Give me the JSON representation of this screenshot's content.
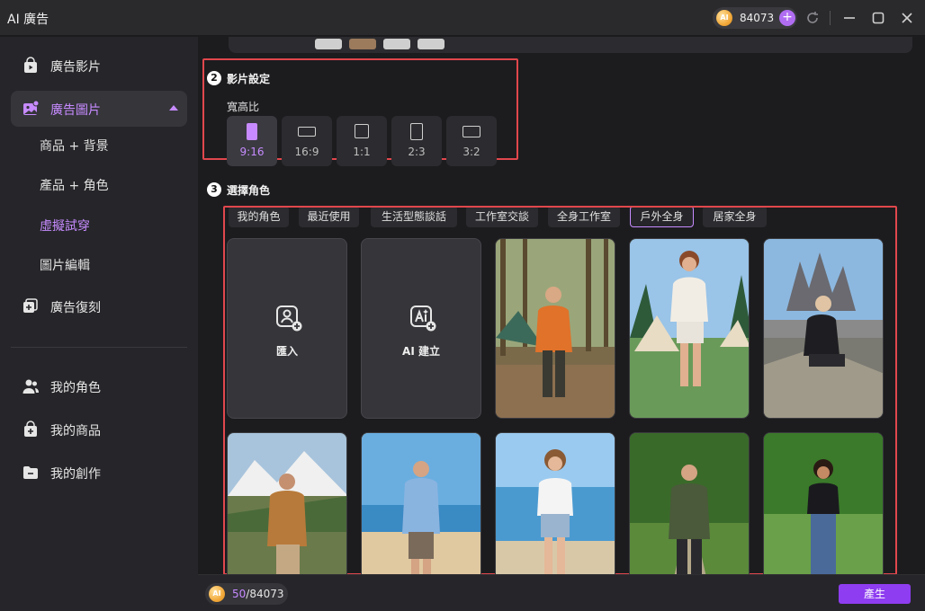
{
  "app": {
    "title": "AI 廣告"
  },
  "titlebar": {
    "credits": "84073",
    "coin_label": "AI"
  },
  "sidebar": {
    "items": [
      {
        "label": "廣告影片",
        "icon": "video-bag-icon"
      },
      {
        "label": "廣告圖片",
        "icon": "image-bag-icon",
        "active": true,
        "expanded": true
      },
      {
        "label": "廣告復刻",
        "icon": "replicate-icon"
      },
      {
        "label": "我的角色",
        "icon": "users-icon"
      },
      {
        "label": "我的商品",
        "icon": "shopping-bag-icon"
      },
      {
        "label": "我的創作",
        "icon": "folder-icon"
      }
    ],
    "sub_items": [
      {
        "label": "商品 + 背景"
      },
      {
        "label": "產品 + 角色"
      },
      {
        "label": "虛擬試穿",
        "active": true
      },
      {
        "label": "圖片編輯"
      }
    ]
  },
  "video_settings": {
    "step": "2",
    "title": "影片設定",
    "aspect_label": "寬高比",
    "ratios": [
      {
        "label": "9:16",
        "active": true
      },
      {
        "label": "16:9"
      },
      {
        "label": "1:1"
      },
      {
        "label": "2:3"
      },
      {
        "label": "3:2"
      }
    ]
  },
  "character_select": {
    "step": "3",
    "title": "選擇角色",
    "tabs": [
      {
        "label": "我的角色"
      },
      {
        "label": "最近使用"
      },
      {
        "label": "生活型態談話"
      },
      {
        "label": "工作室交談"
      },
      {
        "label": "全身工作室"
      },
      {
        "label": "戶外全身",
        "active": true
      },
      {
        "label": "居家全身"
      }
    ],
    "actions": [
      {
        "label": "匯入",
        "icon": "import-user-icon"
      },
      {
        "label": "AI 建立",
        "icon": "ai-create-icon"
      }
    ]
  },
  "bottombar": {
    "used": "50",
    "total": "/84073",
    "generate_label": "產生"
  },
  "colors": {
    "accent": "#c78bff",
    "button": "#8e3df0",
    "highlight": "#e0474c"
  }
}
